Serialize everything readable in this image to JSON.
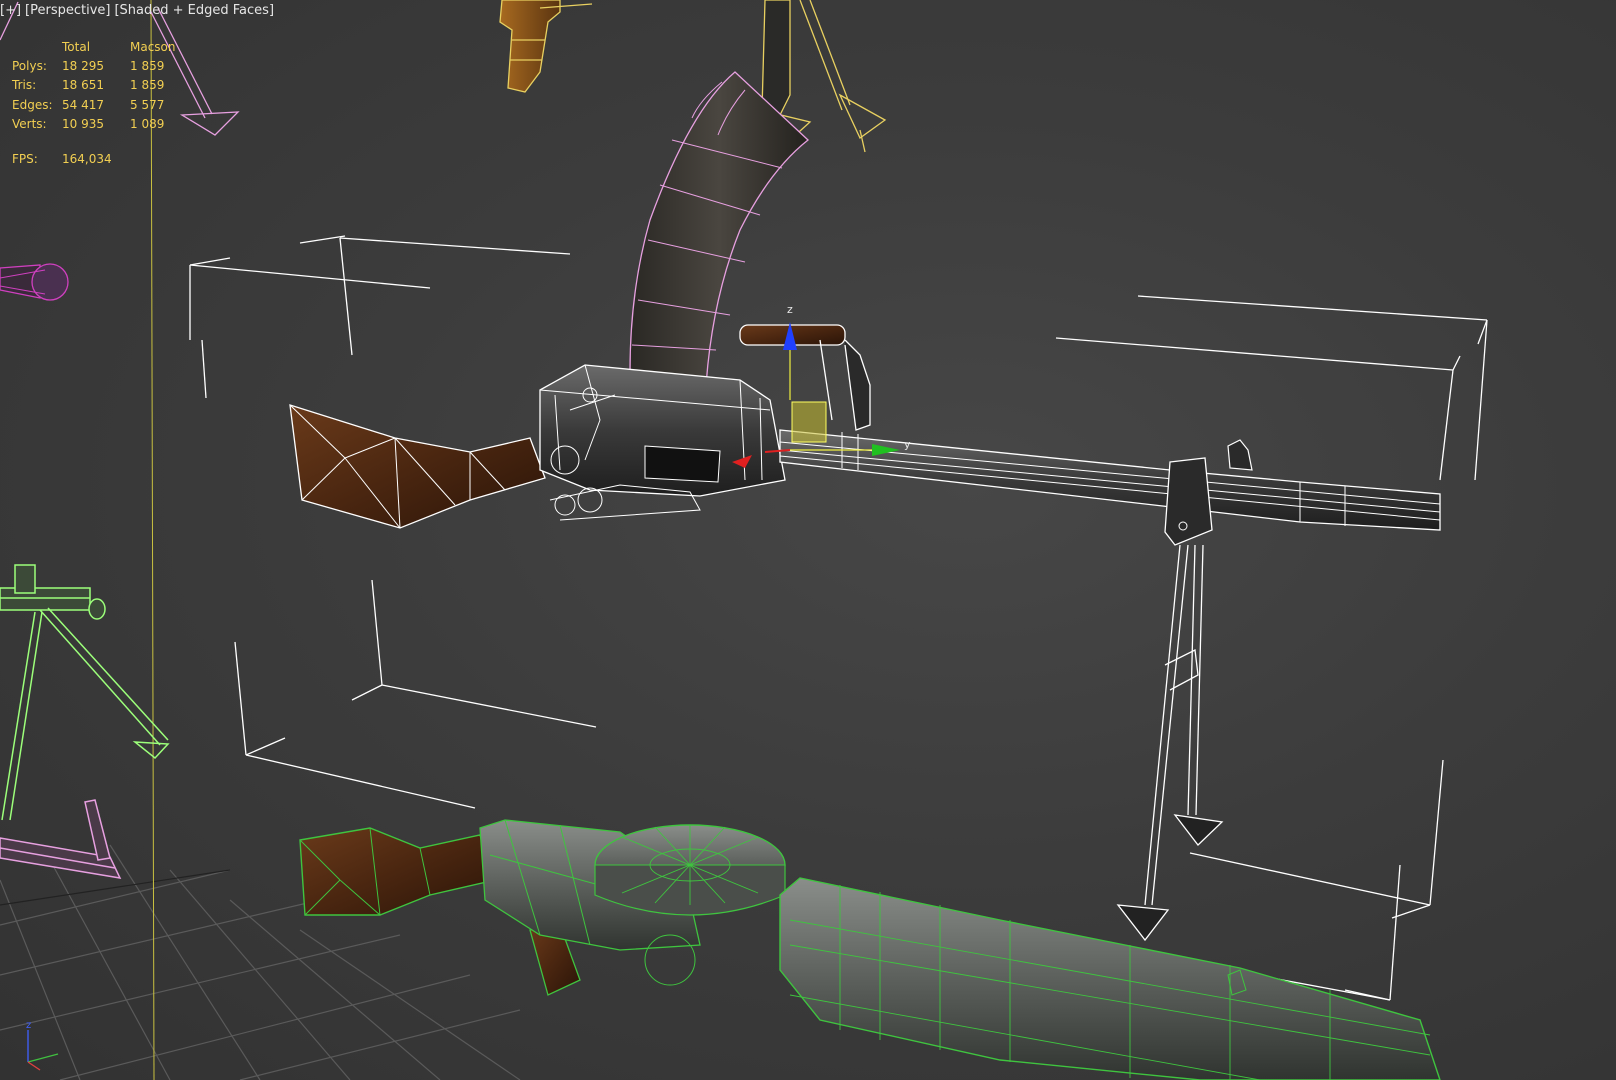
{
  "viewport": {
    "label_parts": [
      "[+]",
      "[Perspective]",
      "[Shaded + Edged Faces]"
    ]
  },
  "stats": {
    "headers": [
      "",
      "Total",
      "Macson"
    ],
    "rows": [
      {
        "label": "Polys:",
        "total": "18 295",
        "selected": "1 859"
      },
      {
        "label": "Tris:",
        "total": "18 651",
        "selected": "1 859"
      },
      {
        "label": "Edges:",
        "total": "54 417",
        "selected": "5 577"
      },
      {
        "label": "Verts:",
        "total": "10 935",
        "selected": "1 089"
      }
    ],
    "fps_label": "FPS:",
    "fps_value": "164,034"
  },
  "gizmo": {
    "axis_z": "z",
    "axis_y": "y"
  },
  "colors": {
    "stats_text": "#f2cf52",
    "viewport_bg": "#3c3c3c",
    "selection_wire": "#ffffff",
    "wire_yellow": "#e8d060",
    "wire_green": "#3fc43f",
    "wire_pink": "#e7a0e0",
    "wire_magenta": "#d040c0",
    "wire_lime": "#9cff7a",
    "axis_x": "#e02020",
    "axis_y": "#20c020",
    "axis_z": "#2040ff"
  }
}
